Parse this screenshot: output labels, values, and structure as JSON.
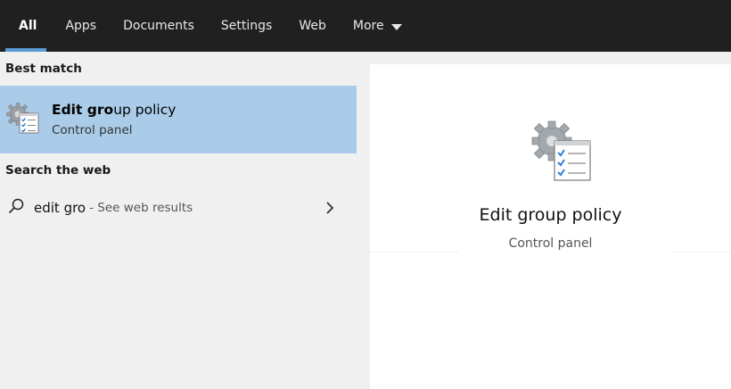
{
  "tabs": [
    {
      "label": "All",
      "active": true
    },
    {
      "label": "Apps",
      "active": false
    },
    {
      "label": "Documents",
      "active": false
    },
    {
      "label": "Settings",
      "active": false
    },
    {
      "label": "Web",
      "active": false
    },
    {
      "label": "More",
      "active": false
    }
  ],
  "left": {
    "best_match_header": "Best match",
    "best_match": {
      "title_bold": "Edit gro",
      "title_rest": "up policy",
      "subtitle": "Control panel",
      "icon": "group-policy-icon"
    },
    "web_header": "Search the web",
    "web_result": {
      "query": "edit gro",
      "suffix": "- See web results",
      "icon": "search-icon"
    }
  },
  "preview": {
    "title": "Edit group policy",
    "subtitle": "Control panel",
    "icon": "group-policy-icon"
  },
  "colors": {
    "topbar": "#202020",
    "accent": "#5b9bd5",
    "selected": "#aacce9",
    "background": "#f0f0f0",
    "panel": "#ffffff"
  }
}
